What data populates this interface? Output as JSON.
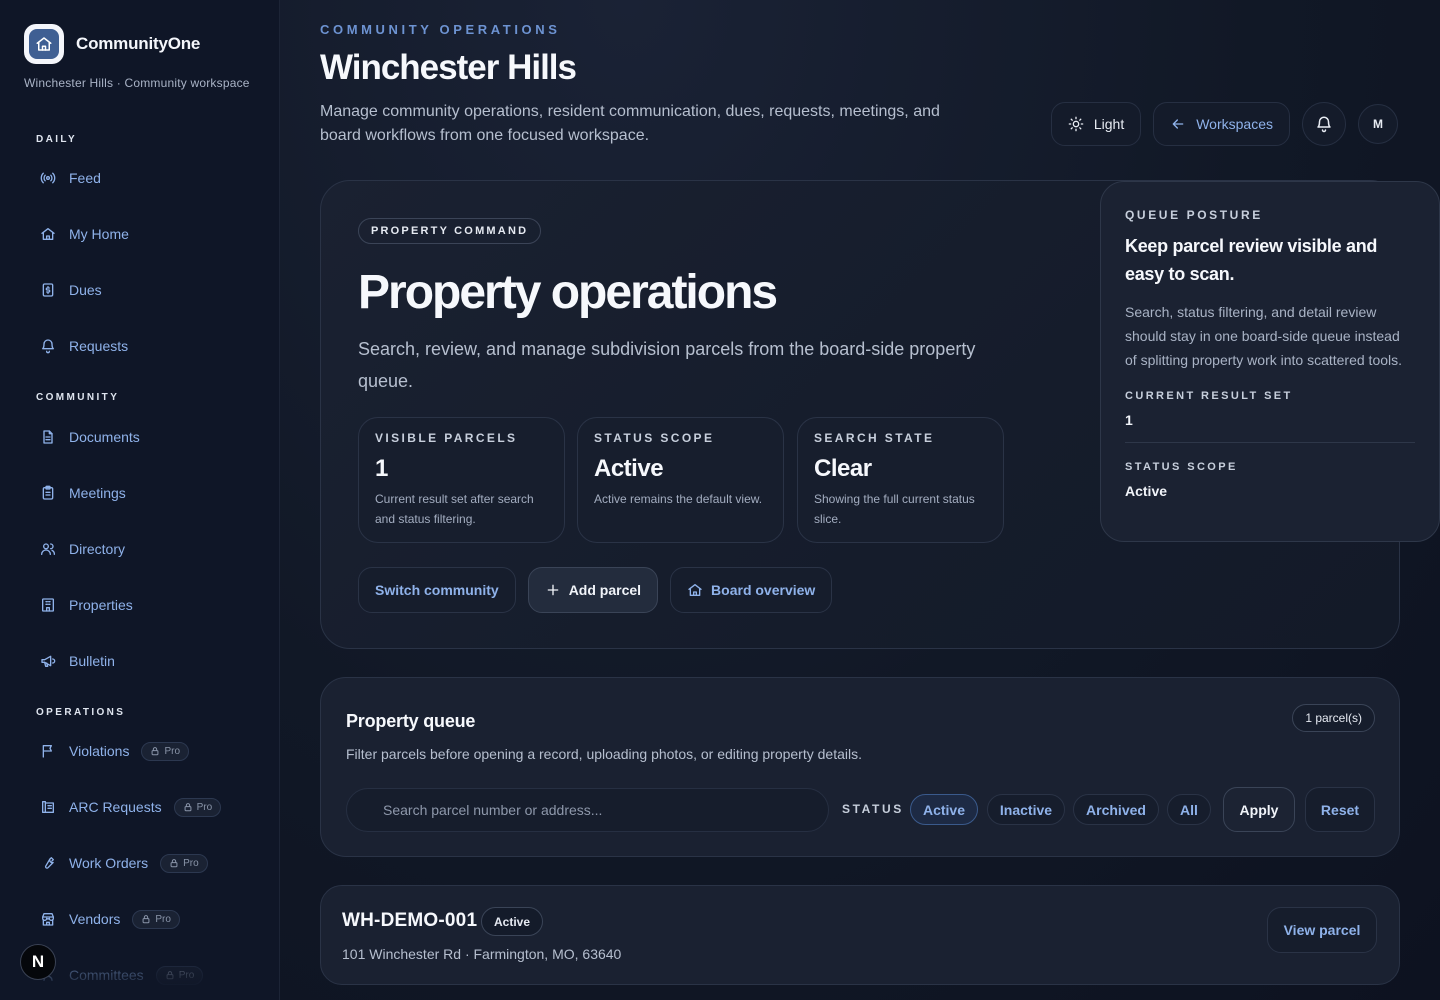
{
  "brand": {
    "name": "CommunityOne",
    "subtitle": "Winchester Hills · Community workspace"
  },
  "sidebar": {
    "sections": [
      "DAILY",
      "COMMUNITY",
      "OPERATIONS"
    ],
    "items": [
      {
        "label": "Feed",
        "icon": "radio-broadcast-icon"
      },
      {
        "label": "My Home",
        "icon": "home-icon"
      },
      {
        "label": "Dues",
        "icon": "receipt-dollar-icon"
      },
      {
        "label": "Requests",
        "icon": "bell-icon"
      },
      {
        "label": "Documents",
        "icon": "document-icon"
      },
      {
        "label": "Meetings",
        "icon": "clipboard-icon"
      },
      {
        "label": "Directory",
        "icon": "users-icon"
      },
      {
        "label": "Properties",
        "icon": "building-icon"
      },
      {
        "label": "Bulletin",
        "icon": "megaphone-icon"
      },
      {
        "label": "Violations",
        "icon": "flag-icon",
        "badge": "Pro"
      },
      {
        "label": "ARC Requests",
        "icon": "blueprint-icon",
        "badge": "Pro"
      },
      {
        "label": "Work Orders",
        "icon": "wrench-icon",
        "badge": "Pro"
      },
      {
        "label": "Vendors",
        "icon": "store-icon",
        "badge": "Pro"
      },
      {
        "label": "Committees",
        "icon": "group-icon",
        "badge": "Pro"
      }
    ],
    "corner_badge": "N"
  },
  "header": {
    "eyebrow": "COMMUNITY OPERATIONS",
    "title": "Winchester Hills",
    "description": "Manage community operations, resident communication, dues, requests, meetings, and board workflows from one focused workspace.",
    "theme_label": "Light",
    "workspaces_label": "Workspaces",
    "avatar_initial": "M"
  },
  "hero": {
    "tag": "PROPERTY COMMAND",
    "title": "Property operations",
    "description": "Search, review, and manage subdivision parcels from the board-side property queue.",
    "stats": [
      {
        "label": "VISIBLE PARCELS",
        "value": "1",
        "help": "Current result set after search and status filtering."
      },
      {
        "label": "STATUS SCOPE",
        "value": "Active",
        "help": "Active remains the default view."
      },
      {
        "label": "SEARCH STATE",
        "value": "Clear",
        "help": "Showing the full current status slice."
      }
    ],
    "actions": {
      "switch": "Switch community",
      "add": "Add parcel",
      "board": "Board overview"
    }
  },
  "posture": {
    "eyebrow": "QUEUE POSTURE",
    "title": "Keep parcel review visible and easy to scan.",
    "description": "Search, status filtering, and detail review should stay in one board-side queue instead of splitting property work into scattered tools.",
    "result_label": "CURRENT RESULT SET",
    "result_value": "1",
    "scope_label": "STATUS SCOPE",
    "scope_value": "Active"
  },
  "queue": {
    "title": "Property queue",
    "count": "1 parcel(s)",
    "description": "Filter parcels before opening a record, uploading photos, or editing property details.",
    "search_placeholder": "Search parcel number or address...",
    "status_label": "STATUS",
    "filters": [
      "Active",
      "Inactive",
      "Archived",
      "All"
    ],
    "selected_filter": "Active",
    "apply_label": "Apply",
    "reset_label": "Reset"
  },
  "parcels": [
    {
      "id": "WH-DEMO-001",
      "status": "Active",
      "address": "101 Winchester Rd · Farmington, MO, 63640",
      "action": "View parcel"
    }
  ]
}
